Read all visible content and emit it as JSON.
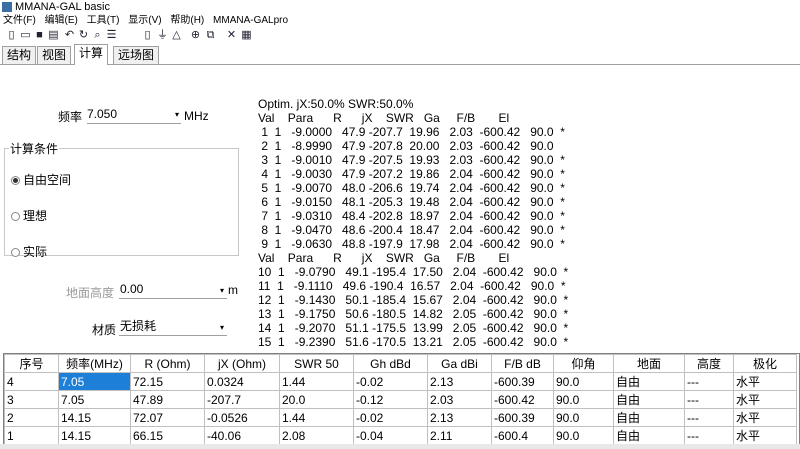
{
  "window": {
    "title": "MMANA-GAL basic"
  },
  "menu": [
    "文件(F)",
    "编辑(E)",
    "工具(T)",
    "显示(V)",
    "帮助(H)",
    "MMANA-GALpro"
  ],
  "toolbar_icons": [
    "new-file-icon",
    "open-folder-icon",
    "save-icon",
    "print-icon",
    "undo-icon",
    "rotate-icon",
    "view-icon",
    "settings-icon",
    "document-icon",
    "ground-icon",
    "triangle-icon",
    "target-icon",
    "copy-icon",
    "tools-icon",
    "calculator-icon"
  ],
  "tabs": [
    "结构",
    "视图",
    "计算",
    "远场图"
  ],
  "active_tab": 2,
  "freq": {
    "label": "频率",
    "value": "7.050",
    "unit": "MHz"
  },
  "calc_conditions": {
    "title": "计算条件",
    "options": [
      "自由空间",
      "理想",
      "实际"
    ],
    "selected": 0
  },
  "ground_height": {
    "label": "地面高度",
    "value": "0.00",
    "unit": "m"
  },
  "material": {
    "label": "材质",
    "value": "无损耗"
  },
  "optim": {
    "header": "Optim. jX:50.0% SWR:50.0%",
    "col_header_1": "Val    Para      R      jX    SWR   Ga     F/B       El",
    "col_header_2": "Val    Para      R      jX    SWR   Ga     F/B       El",
    "rows": [
      " 1  1   -9.0000   47.9 -207.7  19.96   2.03  -600.42   90.0  *",
      " 2  1   -8.9990   47.9 -207.8  20.00   2.03  -600.42   90.0",
      " 3  1   -9.0010   47.9 -207.5  19.93   2.03  -600.42   90.0  *",
      " 4  1   -9.0030   47.9 -207.2  19.86   2.04  -600.42   90.0  *",
      " 5  1   -9.0070   48.0 -206.6  19.74   2.04  -600.42   90.0  *",
      " 6  1   -9.0150   48.1 -205.3  19.48   2.04  -600.42   90.0  *",
      " 7  1   -9.0310   48.4 -202.8  18.97   2.04  -600.42   90.0  *",
      " 8  1   -9.0470   48.6 -200.4  18.47   2.04  -600.42   90.0  *",
      " 9  1   -9.0630   48.8 -197.9  17.98   2.04  -600.42   90.0  *",
      "10  1   -9.0790   49.1 -195.4  17.50   2.04  -600.42   90.0  *",
      "11  1   -9.1110   49.6 -190.4  16.57   2.04  -600.42   90.0  *",
      "12  1   -9.1430   50.1 -185.4  15.67   2.04  -600.42   90.0  *",
      "13  1   -9.1750   50.6 -180.5  14.82   2.05  -600.42   90.0  *",
      "14  1   -9.2070   51.1 -175.5  13.99   2.05  -600.42   90.0  *",
      "15  1   -9.2390   51.6 -170.5  13.21   2.05  -600.42   90.0  *"
    ]
  },
  "results": {
    "headers": [
      "序号",
      "频率(MHz)",
      "R (Ohm)",
      "jX (Ohm)",
      "SWR 50",
      "Gh dBd",
      "Ga dBi",
      "F/B dB",
      "仰角",
      "地面",
      "高度",
      "极化"
    ],
    "rows": [
      [
        "4",
        "7.05",
        "72.15",
        "0.0324",
        "1.44",
        "-0.02",
        "2.13",
        "-600.39",
        "90.0",
        "自由",
        "---",
        "水平"
      ],
      [
        "3",
        "7.05",
        "47.89",
        "-207.7",
        "20.0",
        "-0.12",
        "2.03",
        "-600.42",
        "90.0",
        "自由",
        "---",
        "水平"
      ],
      [
        "2",
        "14.15",
        "72.07",
        "-0.0526",
        "1.44",
        "-0.02",
        "2.13",
        "-600.39",
        "90.0",
        "自由",
        "---",
        "水平"
      ],
      [
        "1",
        "14.15",
        "66.15",
        "-40.06",
        "2.08",
        "-0.04",
        "2.11",
        "-600.4",
        "90.0",
        "自由",
        "---",
        "水平"
      ]
    ]
  }
}
